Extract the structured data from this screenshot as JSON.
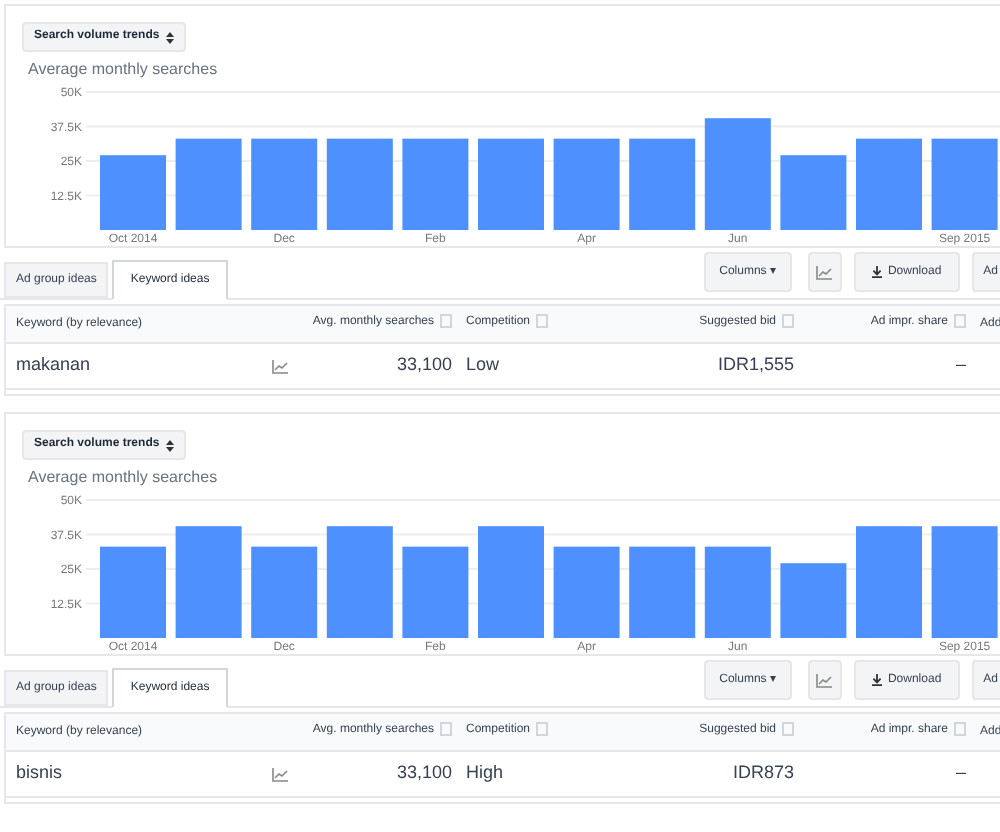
{
  "panels": [
    {
      "dropdown": {
        "label": "Search volume trends"
      },
      "chart_data": {
        "type": "bar",
        "title": "Average monthly searches",
        "grid": true,
        "ylim": [
          0,
          50000
        ],
        "yticks": [
          {
            "value": 12500,
            "label": "12.5K"
          },
          {
            "value": 25000,
            "label": "25K"
          },
          {
            "value": 37500,
            "label": "37.5K"
          },
          {
            "value": 50000,
            "label": "50K"
          }
        ],
        "categories": [
          "Oct 2014",
          null,
          "Dec",
          null,
          "Feb",
          null,
          "Apr",
          null,
          "Jun",
          null,
          null,
          "Sep 2015"
        ],
        "series": [
          {
            "color": "#4d90fe",
            "values": [
              27100,
              33100,
              33100,
              33100,
              33100,
              33100,
              33100,
              33100,
              40500,
              27100,
              33100,
              33100
            ]
          }
        ]
      },
      "tabs": [
        {
          "label": "Ad group ideas",
          "selected": false
        },
        {
          "label": "Keyword ideas",
          "selected": true
        }
      ],
      "toolbar": {
        "columns": "Columns ▾",
        "download": "Download",
        "add": "Ad"
      },
      "table": {
        "columns": [
          {
            "label": "Keyword (by relevance)",
            "help": false
          },
          {
            "label": "Avg. monthly searches",
            "help": true
          },
          {
            "label": "Competition",
            "help": true
          },
          {
            "label": "Suggested bid",
            "help": true
          },
          {
            "label": "Ad impr. share",
            "help": true
          },
          {
            "label": "Add",
            "help": false
          }
        ],
        "rows": [
          {
            "keyword": "makanan",
            "searches": "33,100",
            "competition": "Low",
            "bid": "IDR1,555",
            "impr_share": "–"
          }
        ]
      }
    },
    {
      "dropdown": {
        "label": "Search volume trends"
      },
      "chart_data": {
        "type": "bar",
        "title": "Average monthly searches",
        "grid": true,
        "ylim": [
          0,
          50000
        ],
        "yticks": [
          {
            "value": 12500,
            "label": "12.5K"
          },
          {
            "value": 25000,
            "label": "25K"
          },
          {
            "value": 37500,
            "label": "37.5K"
          },
          {
            "value": 50000,
            "label": "50K"
          }
        ],
        "categories": [
          "Oct 2014",
          null,
          "Dec",
          null,
          "Feb",
          null,
          "Apr",
          null,
          "Jun",
          null,
          null,
          "Sep 2015"
        ],
        "series": [
          {
            "color": "#4d90fe",
            "values": [
              33100,
              40500,
              33100,
              40500,
              33100,
              40500,
              33100,
              33100,
              33100,
              27100,
              40500,
              40500
            ]
          }
        ]
      },
      "tabs": [
        {
          "label": "Ad group ideas",
          "selected": false
        },
        {
          "label": "Keyword ideas",
          "selected": true
        }
      ],
      "toolbar": {
        "columns": "Columns ▾",
        "download": "Download",
        "add": "Ad"
      },
      "table": {
        "columns": [
          {
            "label": "Keyword (by relevance)",
            "help": false
          },
          {
            "label": "Avg. monthly searches",
            "help": true
          },
          {
            "label": "Competition",
            "help": true
          },
          {
            "label": "Suggested bid",
            "help": true
          },
          {
            "label": "Ad impr. share",
            "help": true
          },
          {
            "label": "Add",
            "help": false
          }
        ],
        "rows": [
          {
            "keyword": "bisnis",
            "searches": "33,100",
            "competition": "High",
            "bid": "IDR873",
            "impr_share": "–"
          }
        ]
      }
    }
  ]
}
